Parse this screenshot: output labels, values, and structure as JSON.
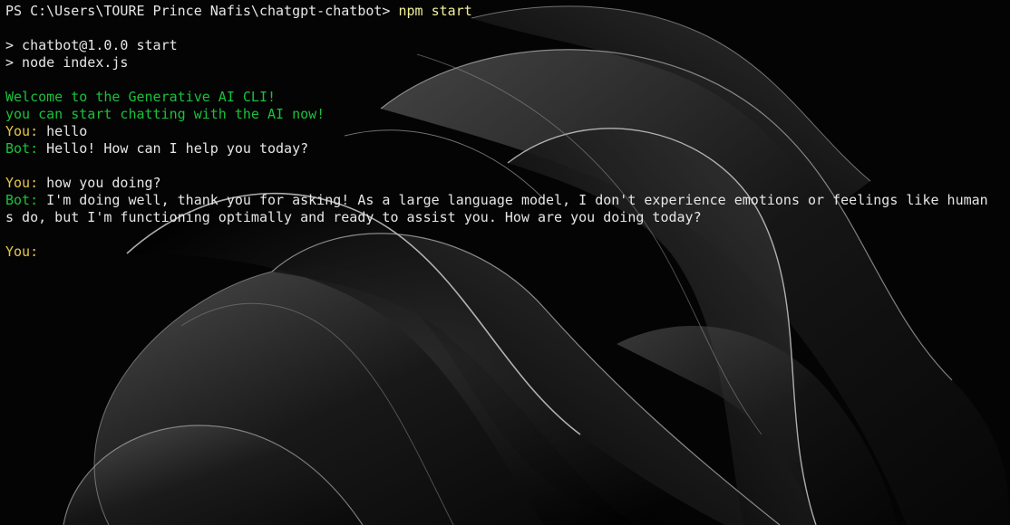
{
  "terminal": {
    "prompt": "PS C:\\Users\\TOURE Prince Nafis\\chatgpt-chatbot>",
    "command": "npm start",
    "script_lines": [
      "> chatbot@1.0.0 start",
      "> node index.js"
    ],
    "welcome": "Welcome to the Generative AI CLI!",
    "start_msg": "you can start chatting with the AI now!",
    "you_label": "You:",
    "bot_label": "Bot:",
    "messages": [
      {
        "role": "you",
        "text": "hello"
      },
      {
        "role": "bot",
        "text": "Hello! How can I help you today?"
      },
      {
        "role": "you",
        "text": "how you doing?"
      },
      {
        "role": "bot",
        "text": "I'm doing well, thank you for asking! As a large language model, I don't experience emotions or feelings like human",
        "continuation": "s do, but I'm functioning optimally and ready to assist you. How are you doing today?"
      }
    ],
    "colors": {
      "background": "#050505",
      "text": "#e6e6e6",
      "green": "#19c23a",
      "yellow": "#e5c64a",
      "command": "#f2ef9a"
    }
  }
}
